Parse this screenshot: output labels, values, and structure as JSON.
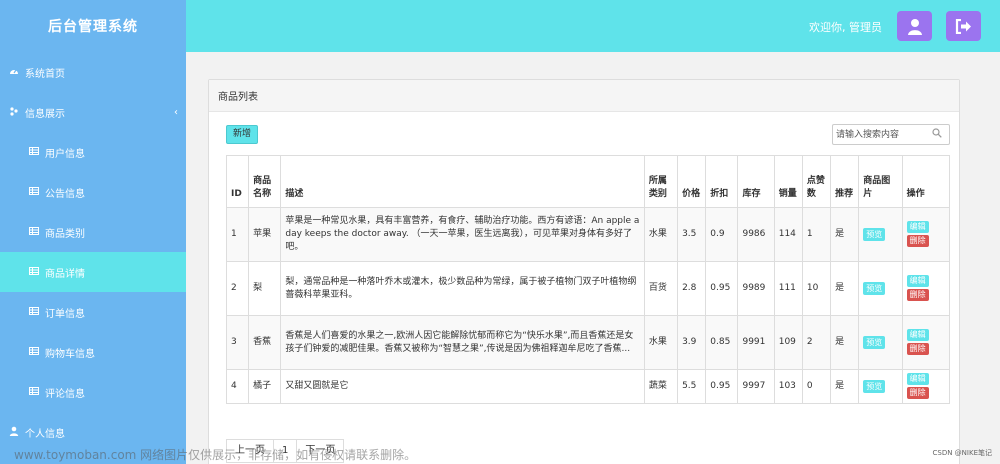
{
  "app": {
    "title": "后台管理系统"
  },
  "sidebar": {
    "items": [
      {
        "label": "系统首页",
        "icon": "dashboard-icon"
      },
      {
        "label": "信息展示",
        "icon": "cluster-icon"
      },
      {
        "label": "用户信息",
        "icon": "table-icon"
      },
      {
        "label": "公告信息",
        "icon": "table-icon"
      },
      {
        "label": "商品类别",
        "icon": "table-icon"
      },
      {
        "label": "商品详情",
        "icon": "table-icon"
      },
      {
        "label": "订单信息",
        "icon": "table-icon"
      },
      {
        "label": "购物车信息",
        "icon": "table-icon"
      },
      {
        "label": "评论信息",
        "icon": "table-icon"
      },
      {
        "label": "个人信息",
        "icon": "user-icon"
      }
    ]
  },
  "header": {
    "welcome": "欢迎你, 管理员"
  },
  "panel": {
    "title": "商品列表",
    "add_label": "新增",
    "search_placeholder": "请输入搜索内容"
  },
  "table": {
    "columns": [
      "ID",
      "商品名称",
      "描述",
      "所属类别",
      "价格",
      "折扣",
      "库存",
      "销量",
      "点赞数",
      "推荐",
      "商品图片",
      "操作"
    ],
    "rows": [
      {
        "id": "1",
        "name": "苹果",
        "desc": "苹果是一种常见水果，具有丰富营养，有食疗、辅助治疗功能。西方有谚语：An apple a day keeps the doctor away. （一天一苹果，医生远离我），可见苹果对身体有多好了吧。",
        "category": "水果",
        "price": "3.5",
        "discount": "0.9",
        "stock": "9986",
        "sales": "114",
        "likes": "1",
        "recommend": "是",
        "preview": "预览",
        "edit": "编辑",
        "delete": "删除"
      },
      {
        "id": "2",
        "name": "梨",
        "desc": "梨，通常品种是一种落叶乔木或灌木，极少数品种为常绿，属于被子植物门双子叶植物纲蔷薇科苹果亚科。",
        "category": "百货",
        "price": "2.8",
        "discount": "0.95",
        "stock": "9989",
        "sales": "111",
        "likes": "10",
        "recommend": "是",
        "preview": "预览",
        "edit": "编辑",
        "delete": "删除"
      },
      {
        "id": "3",
        "name": "香蕉",
        "desc": "香蕉是人们喜爱的水果之一,欧洲人因它能解除忧郁而称它为“快乐水果”,而且香蕉还是女孩子们钟爱的减肥佳果。香蕉又被称为“智慧之果”,传说是因为佛祖释迦牟尼吃了香蕉...",
        "category": "水果",
        "price": "3.9",
        "discount": "0.85",
        "stock": "9991",
        "sales": "109",
        "likes": "2",
        "recommend": "是",
        "preview": "预览",
        "edit": "编辑",
        "delete": "删除"
      },
      {
        "id": "4",
        "name": "橘子",
        "desc": "又甜又圆就是它",
        "category": "蔬菜",
        "price": "5.5",
        "discount": "0.95",
        "stock": "9997",
        "sales": "103",
        "likes": "0",
        "recommend": "是",
        "preview": "预览",
        "edit": "编辑",
        "delete": "删除"
      }
    ]
  },
  "pagination": {
    "prev": "上一页",
    "current": "1",
    "next": "下一页"
  },
  "watermark": "www.toymoban.com 网络图片仅供展示，非存储，如有侵权请联系删除。",
  "credit": "CSDN @NIKE笔记",
  "colors": {
    "sidebar": "#6bb6f0",
    "accent": "#5fe3ea",
    "topButton": "#9b74ef",
    "danger": "#d9534f"
  }
}
